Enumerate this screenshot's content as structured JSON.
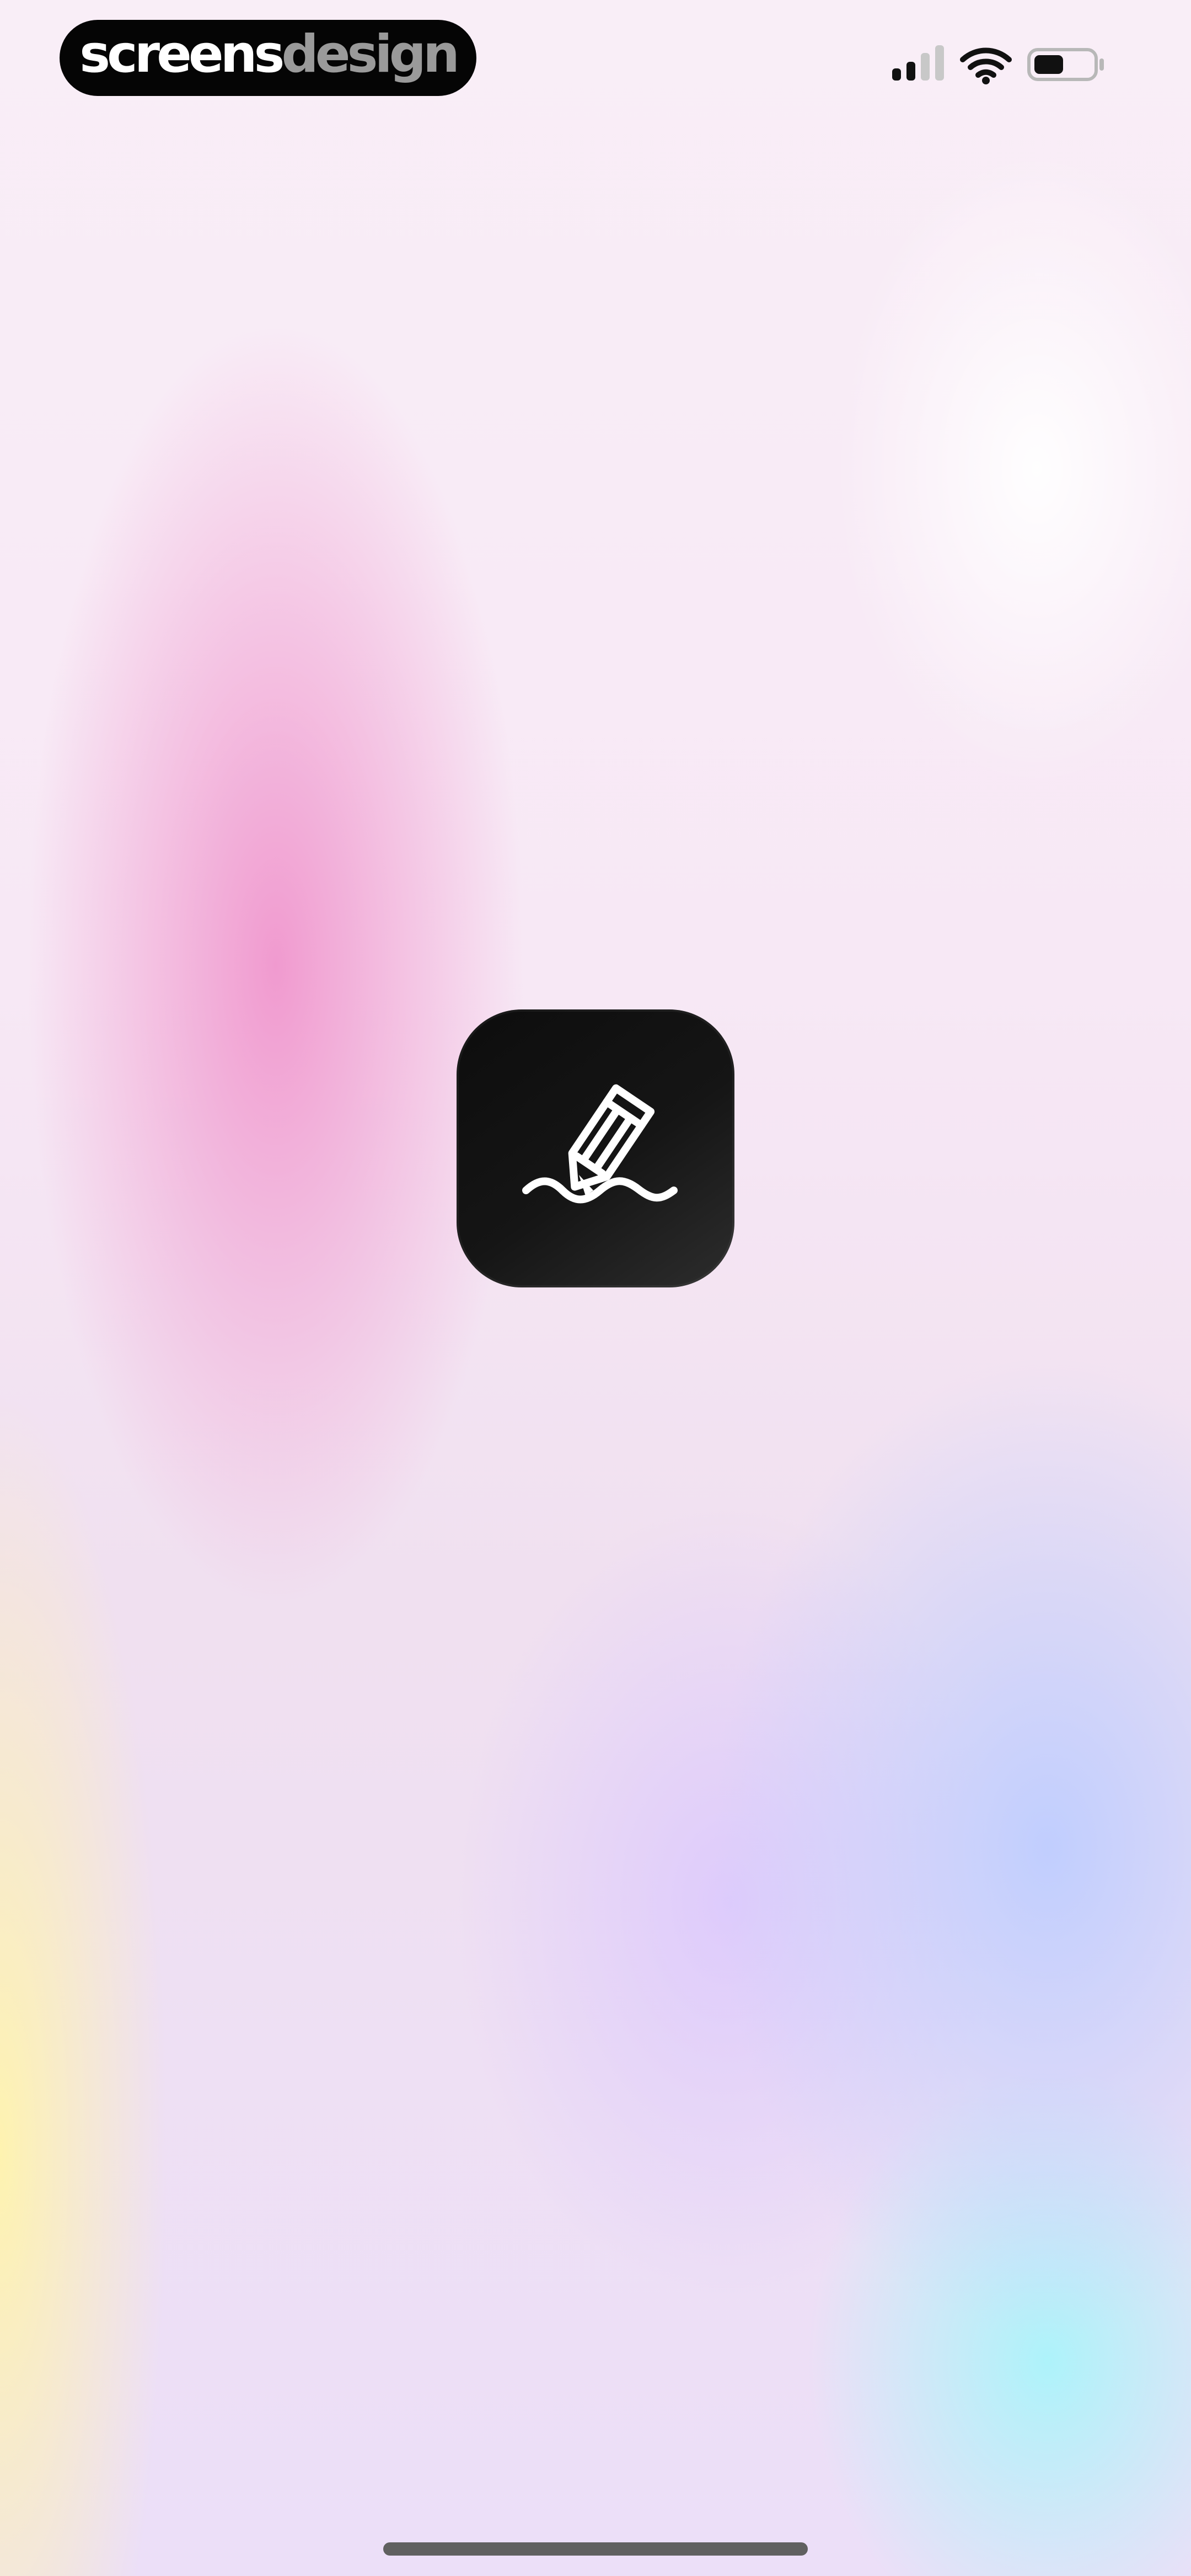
{
  "brand": {
    "screens": "screens",
    "design": "design"
  },
  "icons": {
    "signal": "signal-icon",
    "wifi": "wifi-icon",
    "battery": "battery-icon",
    "pencil": "pencil-icon"
  },
  "colors": {
    "pill_background": "#050505",
    "brand_primary": "#ffffff",
    "brand_secondary": "#9a9a9a",
    "app_icon_background": "#121212",
    "home_indicator": "#606060"
  }
}
